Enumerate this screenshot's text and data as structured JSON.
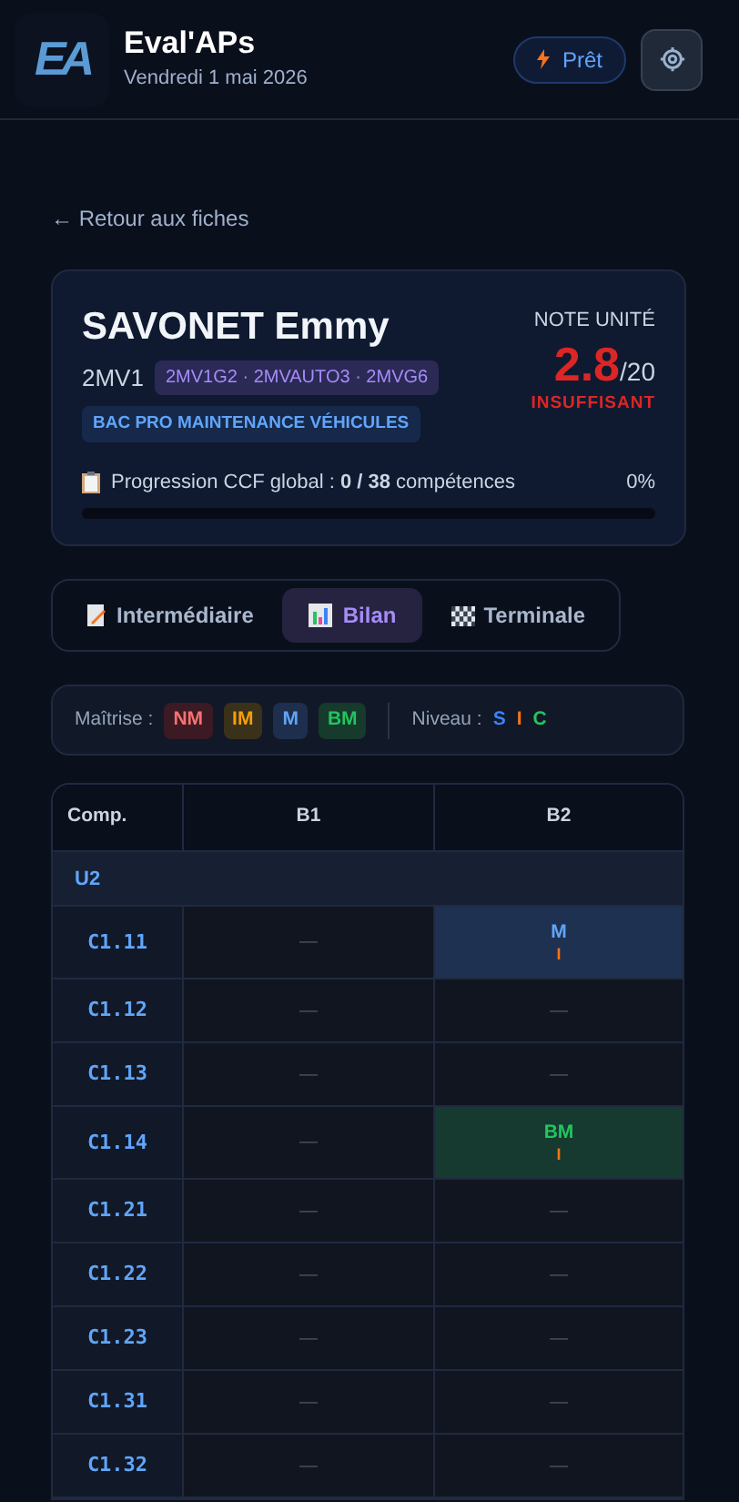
{
  "header": {
    "logo": "EA",
    "title": "Eval'APs",
    "date": "Vendredi 1 mai 2026",
    "status": "Prêt"
  },
  "back_link": "← Retour aux fiches",
  "student": {
    "name": "SAVONET Emmy",
    "class": "2MV1",
    "groups": "2MV1G2 · 2MVAUTO3 · 2MVG6",
    "program": "BAC PRO MAINTENANCE VÉHICULES",
    "grade_label": "NOTE UNITÉ",
    "grade": "2.8",
    "grade_max": "/20",
    "verdict": "INSUFFISANT",
    "progress_prefix": "Progression CCF global : ",
    "progress_count": "0 / 38",
    "progress_suffix": " compétences",
    "progress_percent": "0%",
    "level": 0
  },
  "tabs": [
    {
      "label": "Intermédiaire",
      "kind": "memo",
      "selected": false
    },
    {
      "label": "Bilan",
      "kind": "chart",
      "selected": true
    },
    {
      "label": "Terminale",
      "kind": "flag",
      "selected": false
    }
  ],
  "legend": {
    "mastery_label": "Maîtrise :",
    "mastery": [
      {
        "label": "NM",
        "kind": "nm"
      },
      {
        "label": "IM",
        "kind": "im"
      },
      {
        "label": "M",
        "kind": "m"
      },
      {
        "label": "BM",
        "kind": "bm"
      }
    ],
    "level_label": "Niveau :",
    "levels": [
      {
        "label": "S",
        "kind": "s"
      },
      {
        "label": "I",
        "kind": "i"
      },
      {
        "label": "C",
        "kind": "c"
      }
    ]
  },
  "table": {
    "columns": [
      "Comp.",
      "B1",
      "B2"
    ],
    "group": "U2",
    "rows": [
      {
        "cells": [
          {
            "kind": "comp",
            "text": "C1.11"
          },
          {
            "kind": "empty",
            "text": "—"
          },
          {
            "kind": "eval",
            "mastery": {
              "label": "M",
              "kind": "m"
            },
            "level": {
              "label": "I",
              "kind": "i"
            }
          }
        ]
      },
      {
        "cells": [
          {
            "kind": "comp",
            "text": "C1.12"
          },
          {
            "kind": "empty",
            "text": "—"
          },
          {
            "kind": "empty",
            "text": "—"
          }
        ]
      },
      {
        "cells": [
          {
            "kind": "comp",
            "text": "C1.13"
          },
          {
            "kind": "empty",
            "text": "—"
          },
          {
            "kind": "empty",
            "text": "—"
          }
        ]
      },
      {
        "cells": [
          {
            "kind": "comp",
            "text": "C1.14"
          },
          {
            "kind": "empty",
            "text": "—"
          },
          {
            "kind": "eval",
            "mastery": {
              "label": "BM",
              "kind": "bm"
            },
            "level": {
              "label": "I",
              "kind": "i"
            }
          }
        ]
      },
      {
        "cells": [
          {
            "kind": "comp",
            "text": "C1.21"
          },
          {
            "kind": "empty",
            "text": "—"
          },
          {
            "kind": "empty",
            "text": "—"
          }
        ]
      },
      {
        "cells": [
          {
            "kind": "comp",
            "text": "C1.22"
          },
          {
            "kind": "empty",
            "text": "—"
          },
          {
            "kind": "empty",
            "text": "—"
          }
        ]
      },
      {
        "cells": [
          {
            "kind": "comp",
            "text": "C1.23"
          },
          {
            "kind": "empty",
            "text": "—"
          },
          {
            "kind": "empty",
            "text": "—"
          }
        ]
      },
      {
        "cells": [
          {
            "kind": "comp",
            "text": "C1.31"
          },
          {
            "kind": "empty",
            "text": "—"
          },
          {
            "kind": "empty",
            "text": "—"
          }
        ]
      },
      {
        "cells": [
          {
            "kind": "comp",
            "text": "C1.32"
          },
          {
            "kind": "empty",
            "text": "—"
          },
          {
            "kind": "empty",
            "text": "—"
          }
        ]
      }
    ]
  }
}
